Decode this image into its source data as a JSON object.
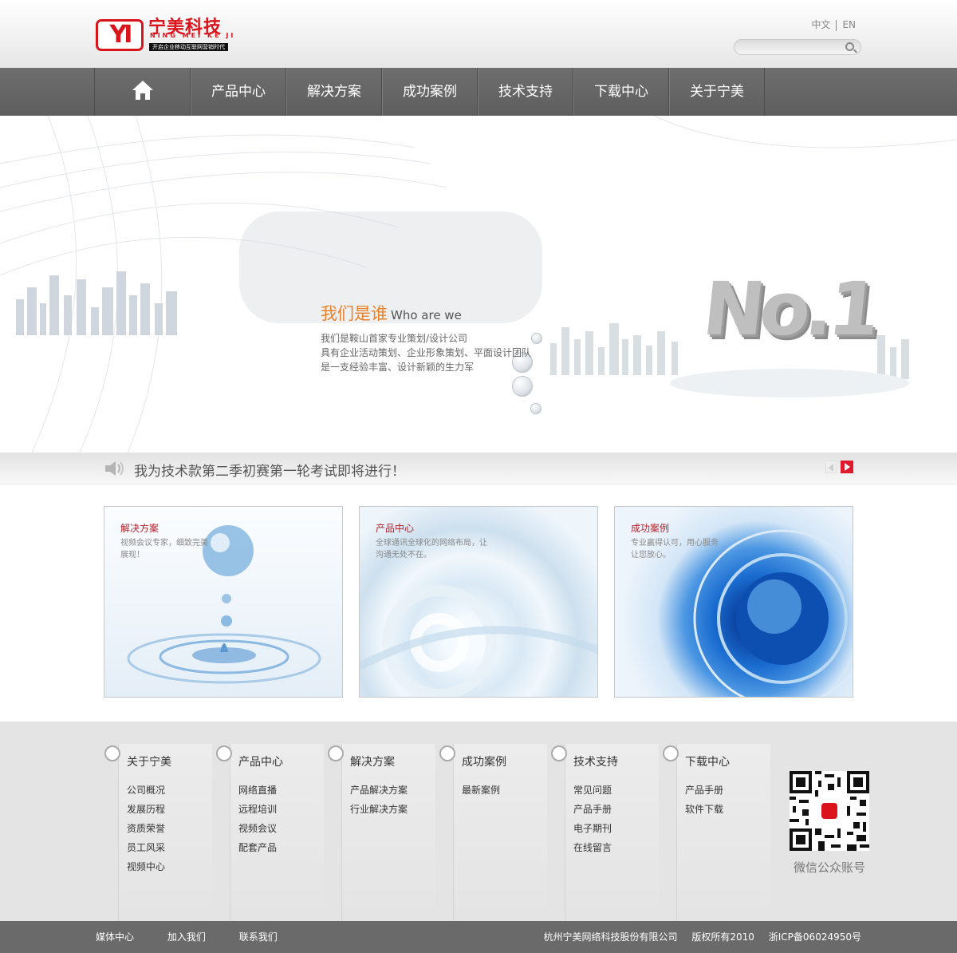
{
  "logo": {
    "mark": "YI",
    "cn": "宁美科技",
    "en": "NING MEI KE JI",
    "slogan": "开启企业移动互联网营销时代"
  },
  "lang": {
    "zh": "中文",
    "en": "EN"
  },
  "search": {
    "placeholder": ""
  },
  "nav": {
    "items": [
      "产品中心",
      "解决方案",
      "成功案例",
      "技术支持",
      "下载中心",
      "关于宁美"
    ]
  },
  "banner": {
    "title": "我们是谁",
    "title_en": "Who are we",
    "lines": [
      "我们是鞍山首家专业策划/设计公司",
      "具有企业活动策划、企业形象策划、平面设计团队",
      "是一支经验丰富、设计新颖的生力军"
    ],
    "no1": "No.1"
  },
  "notice": {
    "text": "我为技术款第二季初赛第一轮考试即将进行！"
  },
  "cards": [
    {
      "title": "解决方案",
      "desc": "视频会议专家，细致完美展现！",
      "title_color": "#b3212a"
    },
    {
      "title": "产品中心",
      "desc": "全球通讯全球化的网络布局，让沟通无处不在。",
      "title_color": "#b3212a"
    },
    {
      "title": "成功案例",
      "desc": "专业赢得认可，用心服务让您放心。",
      "title_color": "#b3212a"
    }
  ],
  "footer": {
    "columns": [
      {
        "title": "关于宁美",
        "items": [
          "公司概况",
          "发展历程",
          "资质荣誉",
          "员工风采",
          "视频中心"
        ]
      },
      {
        "title": "产品中心",
        "items": [
          "网络直播",
          "远程培训",
          "视频会议",
          "配套产品"
        ]
      },
      {
        "title": "解决方案",
        "items": [
          "产品解决方案",
          "行业解决方案"
        ]
      },
      {
        "title": "成功案例",
        "items": [
          "最新案例"
        ]
      },
      {
        "title": "技术支持",
        "items": [
          "常见问题",
          "产品手册",
          "电子期刊",
          "在线留言"
        ]
      },
      {
        "title": "下载中心",
        "items": [
          "产品手册",
          "软件下载"
        ]
      }
    ],
    "qr_label": "微信公众账号"
  },
  "bottom": {
    "links": [
      "媒体中心",
      "加入我们",
      "联系我们"
    ],
    "company": "杭州宁美网络科技股份有限公司",
    "rights": "版权所有2010",
    "icp": "浙ICP备06024950号"
  },
  "colors": {
    "accent": "#e7822a",
    "brand": "#d9141c",
    "nav": "#666666"
  }
}
